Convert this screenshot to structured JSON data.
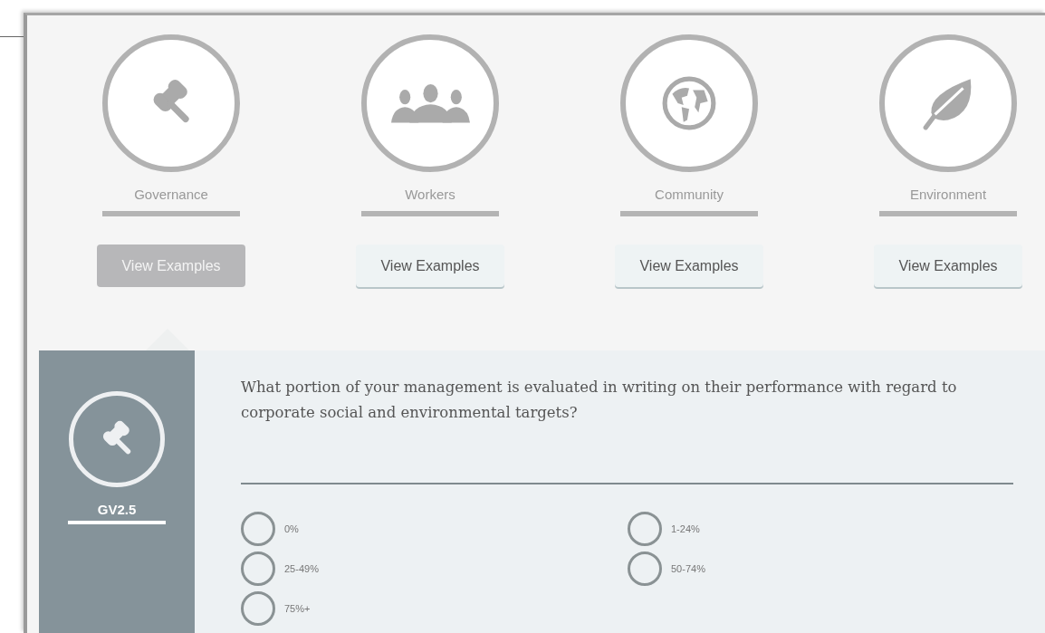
{
  "categories": [
    {
      "kind": "governance",
      "label": "Governance",
      "button": "View Examples",
      "selected": true
    },
    {
      "kind": "workers",
      "label": "Workers",
      "button": "View Examples",
      "selected": false
    },
    {
      "kind": "community",
      "label": "Community",
      "button": "View Examples",
      "selected": false
    },
    {
      "kind": "environment",
      "label": "Environment",
      "button": "View Examples",
      "selected": false
    }
  ],
  "question": {
    "kind": "governance",
    "code": "GV2.5",
    "text": "What portion of your management is evaluated in writing on their performance with regard to corporate social and environmental targets?",
    "options": [
      {
        "label": "0%",
        "selected": false
      },
      {
        "label": "1-24%",
        "selected": false
      },
      {
        "label": "25-49%",
        "selected": false
      },
      {
        "label": "50-74%",
        "selected": false
      },
      {
        "label": "75%+",
        "selected": false
      }
    ]
  }
}
